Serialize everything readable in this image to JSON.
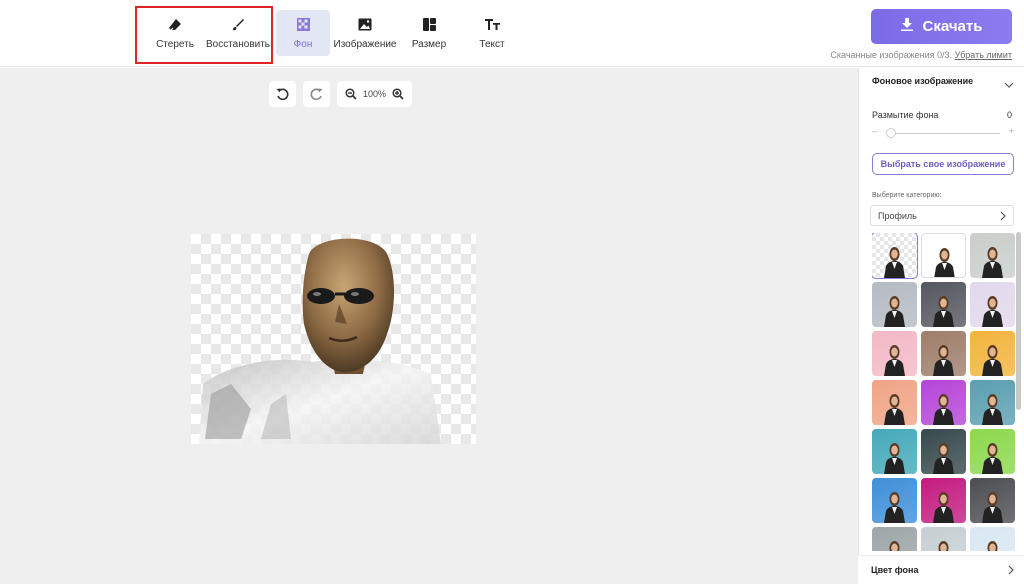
{
  "toolbar": {
    "tools": [
      {
        "label": "Стереть",
        "icon": "eraser-icon"
      },
      {
        "label": "Восстановить",
        "icon": "brush-icon"
      },
      {
        "label": "Фон",
        "icon": "checker-background-icon"
      },
      {
        "label": "Изображение",
        "icon": "image-icon"
      },
      {
        "label": "Размер",
        "icon": "layout-icon"
      },
      {
        "label": "Текст",
        "icon": "text-icon"
      }
    ],
    "active_tool": "Фон"
  },
  "download": {
    "label": "Скачать",
    "info": "Скачанные изображения 0/3.",
    "limit_link": "Убрать лимит"
  },
  "canvas": {
    "zoom": "100%"
  },
  "panel": {
    "section_title": "Фоновое изображение",
    "blur_label": "Размытие фона",
    "blur_value": "0",
    "slider_minus": "–",
    "slider_plus": "+",
    "choose_button": "Выбрать свое изображение",
    "category_label": "Выберите категорию:",
    "category_value": "Профиль",
    "color_section": "Цвет фона"
  },
  "thumbnails": [
    "#transparent",
    "#ffffff",
    "#c9cecb",
    "#b4bbc1",
    "#55575f",
    "#e2d8ec",
    "#f3b8c6",
    "#9e7e6a",
    "#f2b43c",
    "#f0a486",
    "#b545d8",
    "#5a9fb0",
    "#44a9b9",
    "#36494c",
    "#8cd84c",
    "#3f8fd9",
    "#c41b80",
    "#4c4e52",
    "#9ea6a8",
    "#c6d0d4",
    "#d9e8f2"
  ],
  "colors": {
    "accent": "#7b6be6",
    "highlight": "#e02424"
  }
}
